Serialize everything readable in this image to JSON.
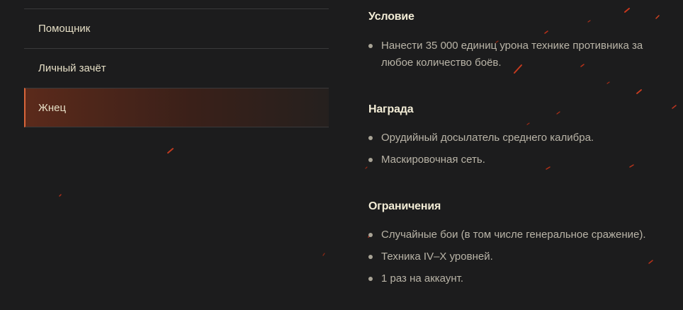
{
  "sidebar": {
    "items": [
      {
        "label": "Помощник",
        "active": false
      },
      {
        "label": "Личный зачёт",
        "active": false
      },
      {
        "label": "Жнец",
        "active": true
      }
    ]
  },
  "sections": {
    "condition": {
      "title": "Условие",
      "items": [
        "Нанести 35 000 единиц урона технике противника за любое количество боёв."
      ]
    },
    "reward": {
      "title": "Награда",
      "items": [
        "Орудийный досылатель среднего калибра.",
        "Маскировочная сеть."
      ]
    },
    "limits": {
      "title": "Ограничения",
      "items": [
        "Случайные бои (в том числе генеральное сражение).",
        "Техника IV–X уровней.",
        "1 раз на аккаунт."
      ]
    }
  },
  "colors": {
    "background": "#1c1c1d",
    "accent": "#d9653a",
    "title_text": "#f2ecd6",
    "body_text": "#b9b4a7"
  }
}
